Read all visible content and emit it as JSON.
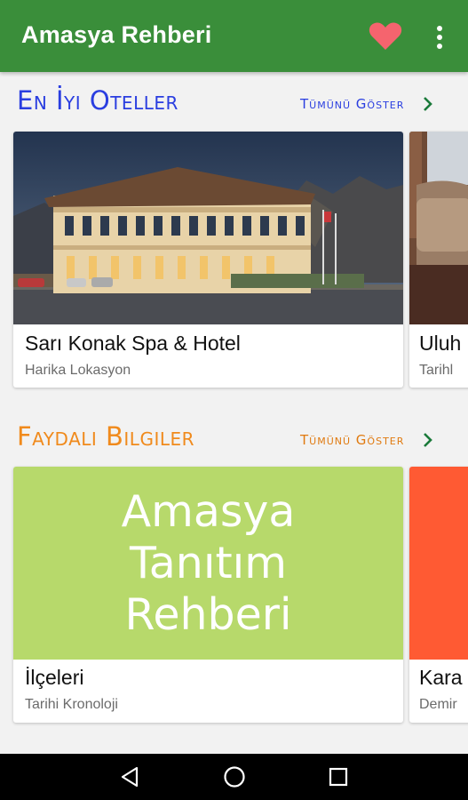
{
  "app": {
    "title": "Amasya Rehberi",
    "accent_color": "#3a8e3a",
    "icons": [
      "heart-icon",
      "more-vert-icon"
    ]
  },
  "hotels_section": {
    "title": "En İyi Oteller",
    "title_color": "#2a3ee0",
    "show_all_label": "Tümünü Göster",
    "show_all_color": "#2a3ee0",
    "cards": [
      {
        "title": "Sarı Konak Spa & Hotel",
        "subtitle": "Harika Lokasyon"
      },
      {
        "title": "Uluh",
        "subtitle": "Tarihl"
      }
    ]
  },
  "info_section": {
    "title": "Faydalı Bilgiler",
    "title_color": "#f08a1c",
    "show_all_label": "Tümünü Göster",
    "show_all_color": "#e07a10",
    "cards": [
      {
        "title": "İlçeleri",
        "subtitle": "Tarihi Kronoloji",
        "image_text_lines": [
          "Amasya",
          "Tanıtım",
          "Rehberi"
        ],
        "image_bg": "#b7d96b"
      },
      {
        "title": "Kara",
        "subtitle": "Demir",
        "image_bg": "#ff5a33"
      }
    ]
  },
  "navbar": {
    "icons": [
      "back-icon",
      "home-icon",
      "recents-icon"
    ]
  }
}
